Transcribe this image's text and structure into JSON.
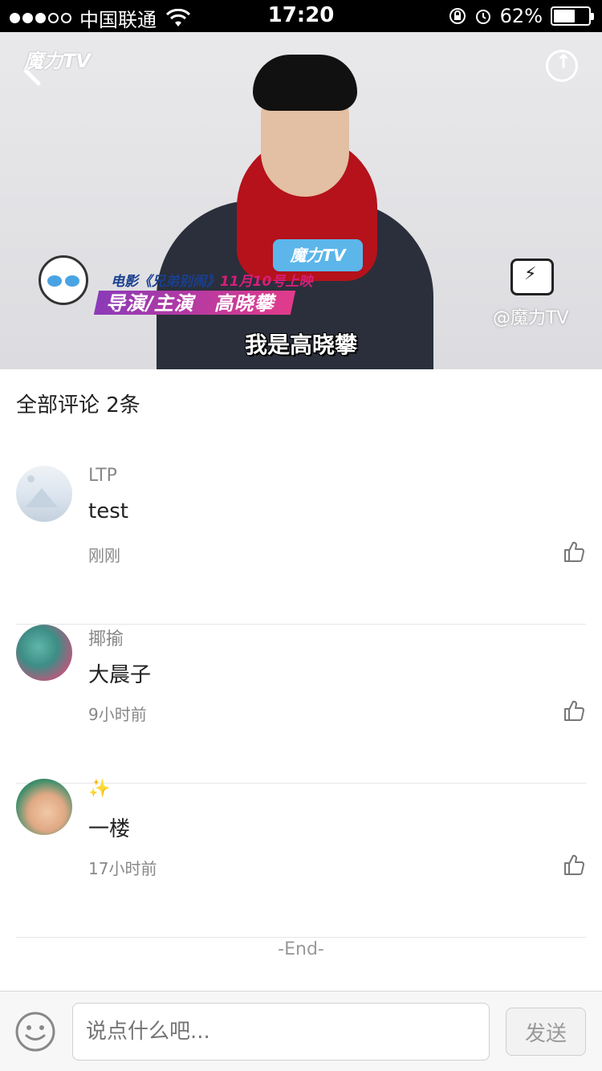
{
  "status_bar": {
    "carrier": "中国联通",
    "time": "17:20",
    "battery_percent": "62%",
    "battery_level": 0.62
  },
  "video": {
    "logo_text": "魔力TV",
    "sign_text": "魔力TV",
    "caption_line1_prefix": "电影《兄弟别闹》",
    "caption_line1_date": "11月10号上映",
    "caption_line2": "导演/主演　高晓攀",
    "subtitle": "我是高晓攀",
    "watermark": "@魔力TV"
  },
  "comments": {
    "header": "全部评论 2条",
    "items": [
      {
        "author": "LTP",
        "text": "test",
        "time": "刚刚"
      },
      {
        "author": "揶揄",
        "text": "大晨子",
        "time": "9小时前"
      },
      {
        "author": "✨",
        "text": "一楼",
        "time": "17小时前"
      }
    ],
    "end_text": "-End-"
  },
  "bottom_bar": {
    "input_placeholder": "说点什么吧...",
    "send_label": "发送"
  }
}
